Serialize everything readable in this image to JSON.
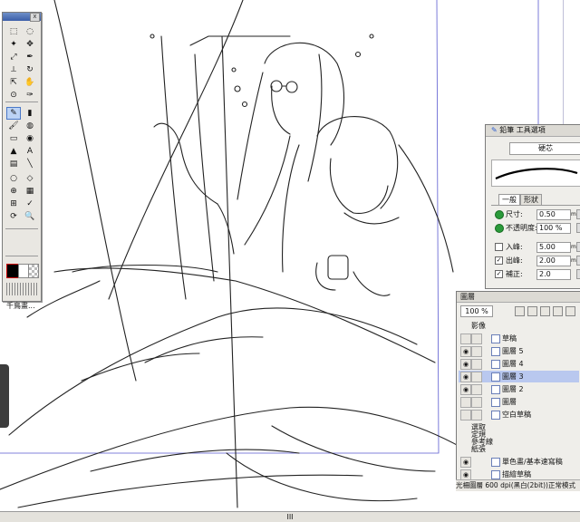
{
  "toolbox": {
    "close_label": "x",
    "label": "千鳥畫...",
    "tools": [
      "marquee-icon",
      "lasso-icon",
      "magic-wand-icon",
      "move-icon",
      "zoom-selection-icon",
      "pen-icon",
      "ruler-icon",
      "rotate-icon",
      "layer-move-icon",
      "hand-icon",
      "eyedropper-icon",
      "pen-tool-icon",
      "pencil-icon",
      "marker-icon",
      "brush-icon",
      "airbrush-icon",
      "eraser-icon",
      "blur-icon",
      "fill-icon",
      "text-icon",
      "gradient-icon",
      "line-icon",
      "ellipse-icon",
      "shape-icon",
      "stamp-icon",
      "pattern-icon",
      "object-icon",
      "correct-icon",
      "rotate-view-icon",
      "zoom-icon"
    ]
  },
  "tool_options": {
    "title": "鉛筆 工具選項",
    "subtool": "硬芯",
    "tabs": [
      "一般",
      "形狀"
    ],
    "props": [
      {
        "label": "尺寸:",
        "value": "0.50",
        "unit": "mm",
        "kind": "dot"
      },
      {
        "label": "不透明度:",
        "value": "100 %",
        "unit": "",
        "kind": "dot"
      },
      {
        "label": "入峰:",
        "value": "5.00",
        "unit": "mm",
        "kind": "cb",
        "checked": false
      },
      {
        "label": "出峰:",
        "value": "2.00",
        "unit": "mm",
        "kind": "cb",
        "checked": true
      },
      {
        "label": "補正:",
        "value": "2.0",
        "unit": "",
        "kind": "cb",
        "checked": true
      }
    ]
  },
  "layers": {
    "title": "圖層",
    "zoom": "100 %",
    "folder_image": "影像",
    "rows": [
      {
        "name": "草稿",
        "selected": false,
        "visible": false
      },
      {
        "name": "圖層 5",
        "selected": false,
        "visible": true
      },
      {
        "name": "圖層 4",
        "selected": false,
        "visible": true
      },
      {
        "name": "圖層 3",
        "selected": true,
        "visible": true
      },
      {
        "name": "圖層 2",
        "selected": false,
        "visible": true
      },
      {
        "name": "圖層",
        "selected": false,
        "visible": false
      },
      {
        "name": "空白草稿",
        "selected": false,
        "visible": false
      }
    ],
    "groups": [
      "選取",
      "定規",
      "參考線",
      "紙張"
    ],
    "paper_rows": [
      {
        "name": "單色畫/基本速寫稿"
      },
      {
        "name": "描繪草稿"
      }
    ],
    "status": "光柵圖層 600 dpi(黑白(2bit))正常模式"
  },
  "scrollbar": {
    "thumb_label": "III"
  }
}
